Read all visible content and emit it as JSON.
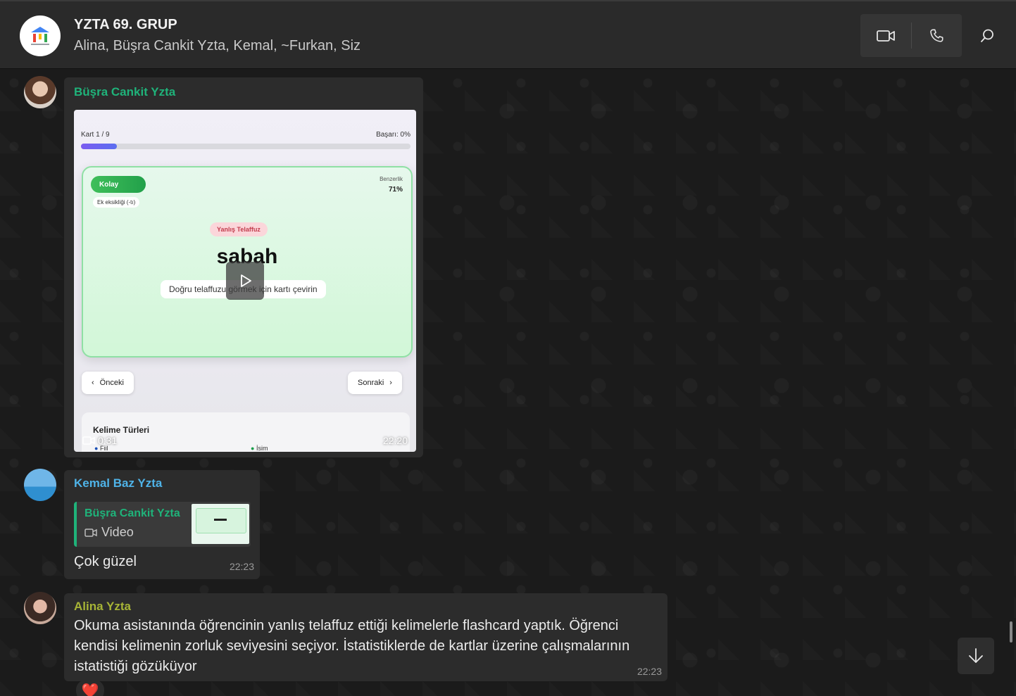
{
  "header": {
    "title": "YZTA 69. GRUP",
    "members": "Alina, Büşra Cankit Yzta, Kemal, ~Furkan, Siz",
    "video_call_icon": "video-camera-icon",
    "voice_call_icon": "phone-icon",
    "search_icon": "search-icon"
  },
  "messages": [
    {
      "sender": "Büşra Cankit Yzta",
      "sender_color": "#1fb37a",
      "type": "video",
      "duration": "0:31",
      "time": "22:20",
      "video_frame": {
        "card_counter": "Kart 1 / 9",
        "success": "Başarı: 0%",
        "progress_fraction": 0.11,
        "difficulty": "Kolay",
        "tag": "Ek eksikliği (-tı)",
        "similarity_label": "Benzerlik",
        "similarity_value": "71%",
        "badge": "Yanlış Telaffuz",
        "word": "sabah",
        "hint": "Doğru telaffuzu görmek için kartı çevirin",
        "prev": "Önceki",
        "next": "Sonraki",
        "section": "Kelime Türleri",
        "legend_1": "Fiil",
        "legend_2": "İsim"
      }
    },
    {
      "sender": "Kemal Baz Yzta",
      "sender_color": "#4fb3e8",
      "quote": {
        "sender": "Büşra Cankit Yzta",
        "label": "Video"
      },
      "text": "Çok güzel",
      "time": "22:23"
    },
    {
      "sender": "Alina Yzta",
      "sender_color": "#a7b436",
      "text": "Okuma asistanında öğrencinin yanlış telaffuz ettiği kelimelerle flashcard yaptık. Öğrenci kendisi kelimenin zorluk seviyesini seçiyor. İstatistiklerde de kartlar üzerine çalışmalarının istatistiği gözüküyor",
      "time": "22:23",
      "reaction": "❤️"
    }
  ]
}
